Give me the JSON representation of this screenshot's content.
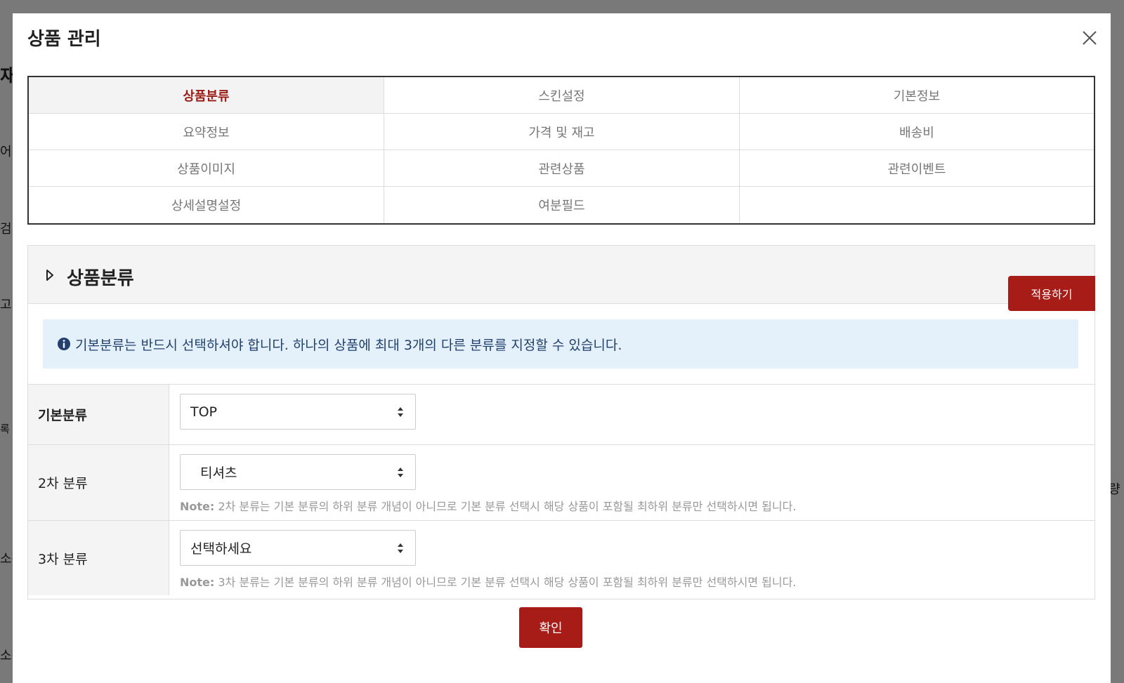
{
  "background": {
    "fragments": [
      "재",
      "어",
      "검",
      "고",
      "록",
      "소장",
      "소장",
      "량"
    ]
  },
  "modal": {
    "title": "상품 관리",
    "close_icon": "close-icon"
  },
  "tabs": [
    {
      "label": "상품분류",
      "active": true
    },
    {
      "label": "스킨설정",
      "active": false
    },
    {
      "label": "기본정보",
      "active": false
    },
    {
      "label": "요약정보",
      "active": false
    },
    {
      "label": "가격 및 재고",
      "active": false
    },
    {
      "label": "배송비",
      "active": false
    },
    {
      "label": "상품이미지",
      "active": false
    },
    {
      "label": "관련상품",
      "active": false
    },
    {
      "label": "관련이벤트",
      "active": false
    },
    {
      "label": "상세설명설정",
      "active": false
    },
    {
      "label": "여분필드",
      "active": false
    },
    {
      "label": "",
      "active": false
    }
  ],
  "section": {
    "title": "상품분류",
    "apply_label": "적용하기",
    "notice": "기본분류는 반드시 선택하셔야 합니다. 하나의 상품에 최대 3개의 다른 분류를 지정할 수 있습니다."
  },
  "form": {
    "rows": [
      {
        "label": "기본분류",
        "value": "TOP",
        "note_prefix": "",
        "note": ""
      },
      {
        "label": "2차 분류",
        "value": "티셔츠",
        "note_prefix": "Note:",
        "note": "2차 분류는 기본 분류의 하위 분류 개념이 아니므로 기본 분류 선택시 해당 상품이 포함될 최하위 분류만 선택하시면 됩니다."
      },
      {
        "label": "3차 분류",
        "value": "선택하세요",
        "note_prefix": "Note:",
        "note": "3차 분류는 기본 분류의 하위 분류 개념이 아니므로 기본 분류 선택시 해당 상품이 포함될 최하위 분류만 선택하시면 됩니다."
      }
    ]
  },
  "confirm_label": "확인",
  "colors": {
    "accent": "#a81c17",
    "notice_bg": "#e4f1fb",
    "notice_text": "#22406e"
  }
}
